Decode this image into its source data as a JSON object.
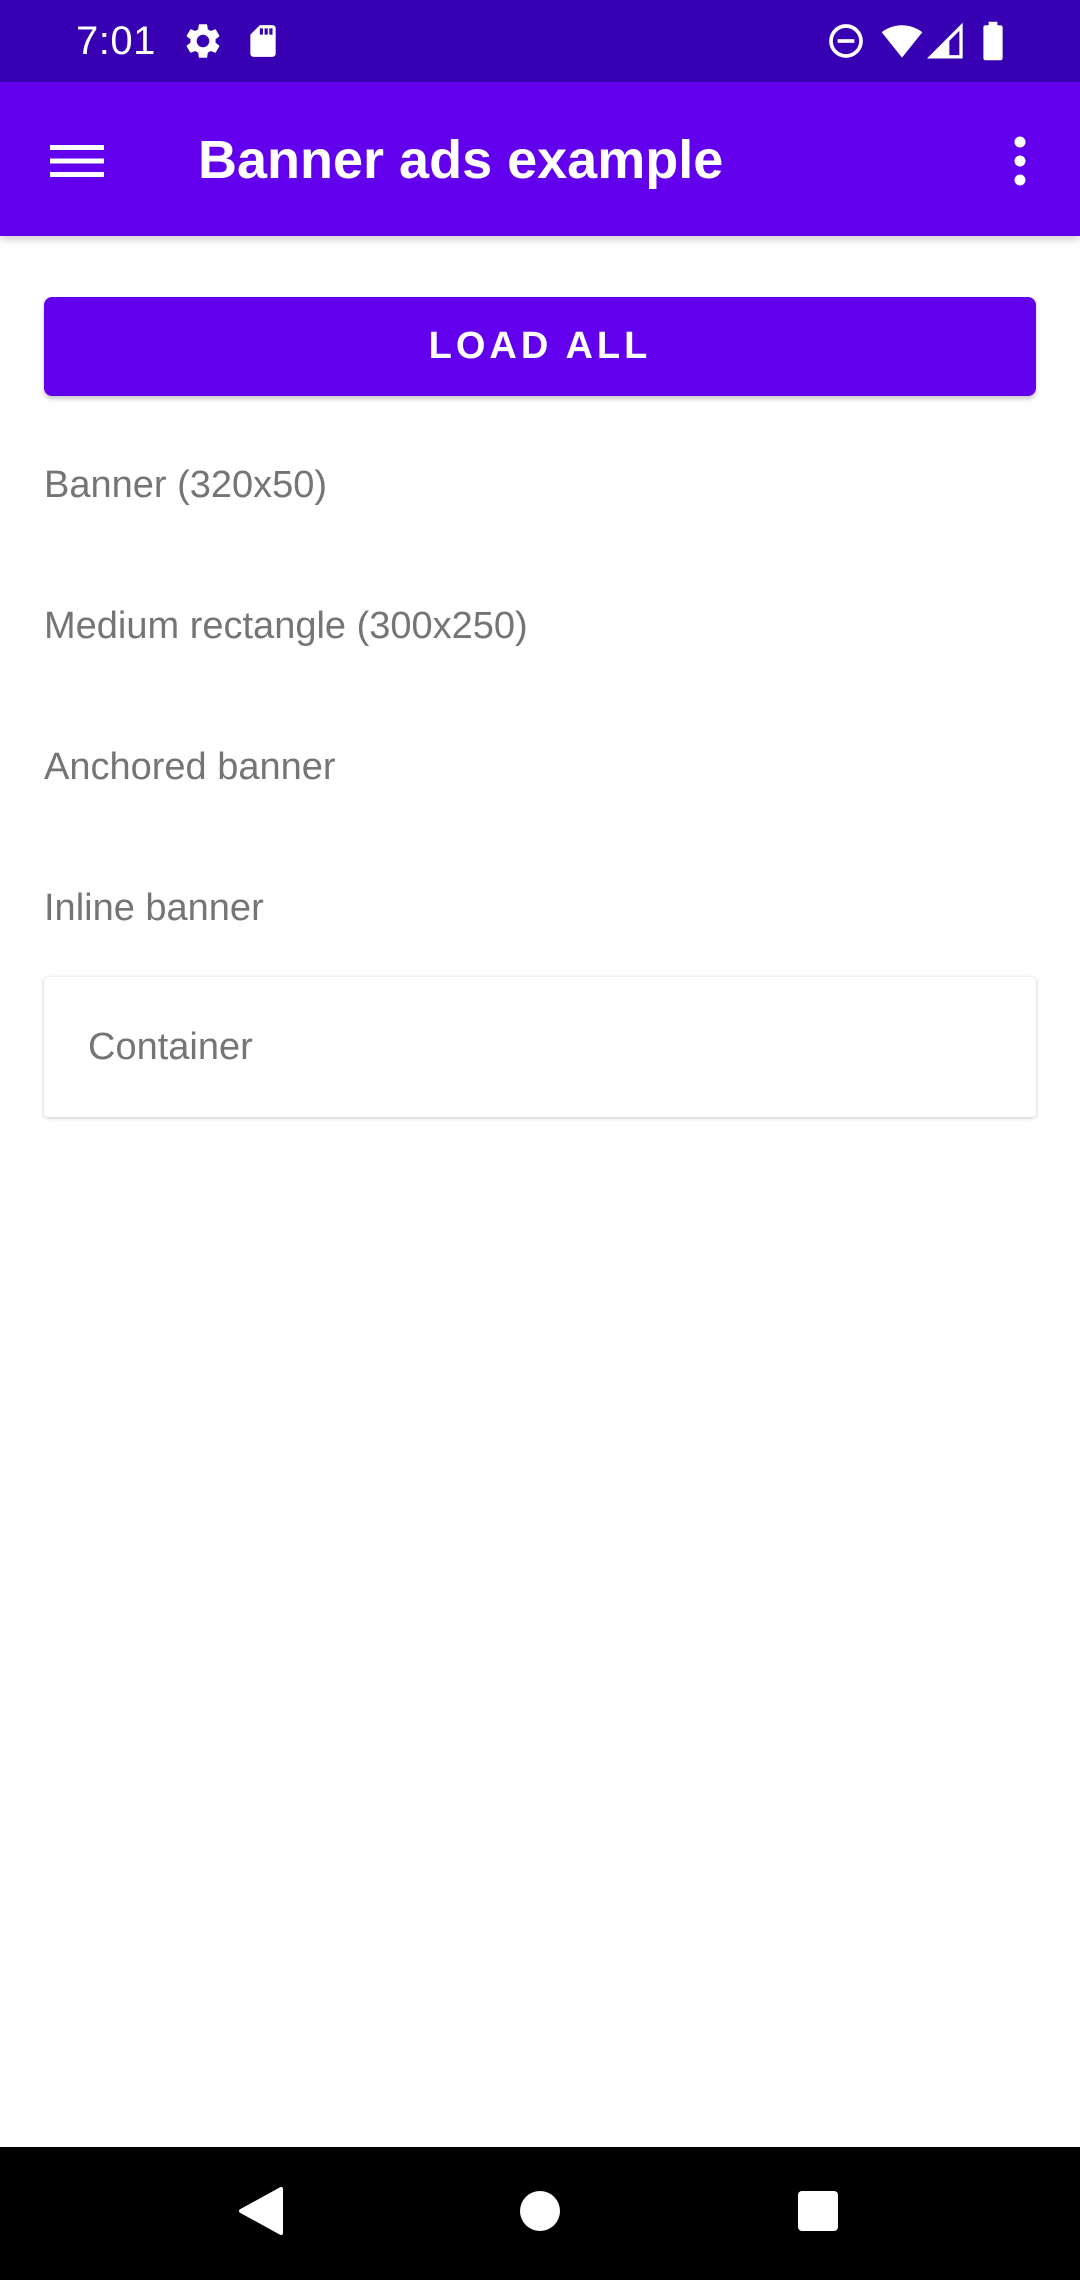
{
  "status_bar": {
    "time": "7:01",
    "background": "#3700B3",
    "left_icons": [
      "settings-icon",
      "sd-card-icon"
    ],
    "right_icons": [
      "do-not-disturb-icon",
      "wifi-icon",
      "cellular-signal-icon",
      "battery-icon"
    ]
  },
  "app_bar": {
    "title": "Banner ads example",
    "background": "#6200EE",
    "menu_icon": "hamburger-menu-icon",
    "overflow_icon": "more-vertical-icon"
  },
  "main": {
    "load_all_label": "LOAD ALL",
    "accent": "#6200EE",
    "ad_items": [
      {
        "label": "Banner (320x50)"
      },
      {
        "label": "Medium rectangle (300x250)"
      },
      {
        "label": "Anchored banner"
      },
      {
        "label": "Inline banner"
      }
    ],
    "container_label": "Container"
  },
  "nav_bar": {
    "buttons": [
      "back-icon",
      "home-icon",
      "recents-icon"
    ]
  }
}
